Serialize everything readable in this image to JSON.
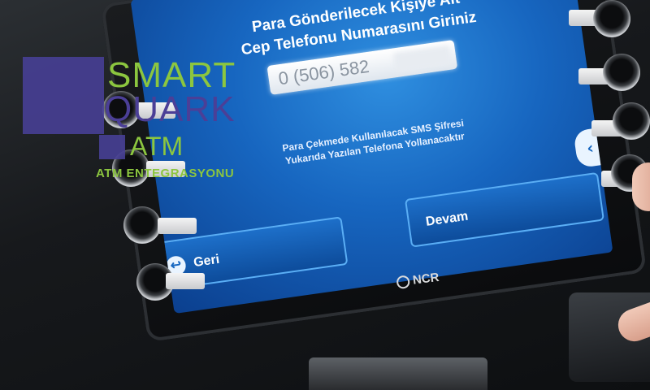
{
  "screen": {
    "line1": "Para Gönderilecek Kişiye Ait",
    "line2": "Cep Telefonu Numarasını Giriniz",
    "phone_value": "0 (506) 582",
    "sms_line1": "Para Çekmede Kullanılacak SMS Şifresi",
    "sms_line2": "Yukarıda Yazılan Telefona Yollanacaktır",
    "back_button_label": "Geri",
    "continue_button_label": "Devam"
  },
  "device": {
    "brand": "NCR"
  },
  "logo": {
    "line1": "SMART",
    "line2": "QUARK",
    "line3": "ATM",
    "tagline": "ATM ENTEGRASYONU"
  },
  "colors": {
    "screen_blue": "#1766c0",
    "logo_green": "#8cc63f",
    "logo_purple": "#473f95"
  }
}
